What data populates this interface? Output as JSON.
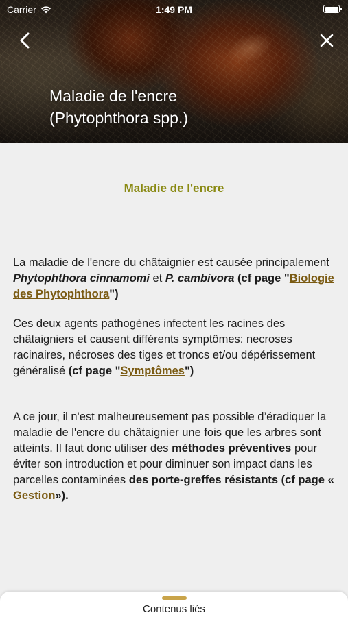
{
  "status_bar": {
    "carrier": "Carrier",
    "time": "1:49 PM"
  },
  "header": {
    "title_line1": "Maladie de l'encre",
    "title_line2": "(Phytophthora spp.)"
  },
  "content": {
    "heading": "Maladie de l'encre",
    "p1": {
      "t1": "La maladie de l'encre du châtaignier est causée principalement ",
      "species1": "Phytophthora cinnamomi",
      "t2": " et ",
      "species2": "P. cambivora",
      "ref_open": " (cf page \"",
      "link": "Biologie des Phytophthora",
      "ref_close": "\")"
    },
    "p2": {
      "t1": "Ces deux agents pathogènes infectent les racines des châtaigniers et causent différents symptômes: necroses racinaires, nécroses des tiges et troncs et/ou dépérissement généralisé ",
      "ref_open": "(cf page \"",
      "link": "Symptômes",
      "ref_close": "\")"
    },
    "p3": {
      "t1": "A ce jour, il n'est malheureusement pas possible d’éradiquer la maladie de l'encre du châtaignier une fois que les arbres sont atteints. Il faut donc utiliser des ",
      "bold1": "méthodes préventives",
      "t2": " pour éviter son introduction et pour diminuer son impact dans les parcelles contaminées ",
      "bold2": "des porte-greffes résistants (cf page « ",
      "link": "Gestion",
      "ref_close": "»)."
    }
  },
  "bottom_sheet": {
    "label": "Contenus liés"
  },
  "colors": {
    "heading": "#8a8a14",
    "link": "#7a5a12",
    "handle": "#c9a44a",
    "background": "#efefef"
  }
}
